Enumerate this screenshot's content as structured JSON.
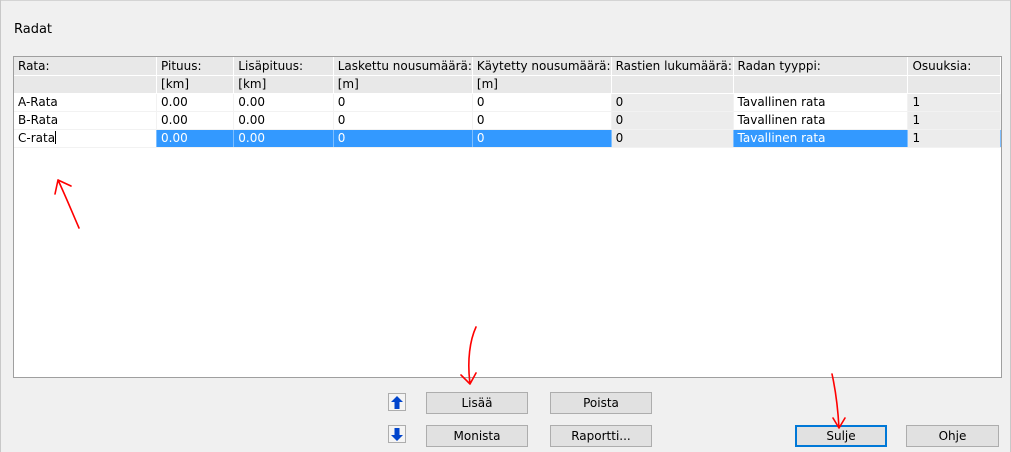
{
  "window": {
    "title": "Radat"
  },
  "table": {
    "columns": [
      {
        "label": "Rata:",
        "unit": ""
      },
      {
        "label": "Pituus:",
        "unit": "[km]"
      },
      {
        "label": "Lisäpituus:",
        "unit": "[km]"
      },
      {
        "label": "Laskettu nousumäärä:",
        "unit": "[m]"
      },
      {
        "label": "Käytetty nousumäärä:",
        "unit": "[m]"
      },
      {
        "label": "Rastien lukumäärä:",
        "unit": ""
      },
      {
        "label": "Radan tyyppi:",
        "unit": ""
      },
      {
        "label": "Osuuksia:",
        "unit": ""
      }
    ],
    "rows": [
      {
        "cells": [
          "A-Rata",
          "0.00",
          "0.00",
          "0",
          "0",
          "0",
          "Tavallinen rata",
          "1"
        ]
      },
      {
        "cells": [
          "B-Rata",
          "0.00",
          "0.00",
          "0",
          "0",
          "0",
          "Tavallinen rata",
          "1"
        ]
      },
      {
        "cells": [
          "C-rata",
          "0.00",
          "0.00",
          "0",
          "0",
          "0",
          "Tavallinen rata",
          "1"
        ],
        "selected": true
      }
    ]
  },
  "buttons": {
    "move_up_icon": "arrow-up-icon",
    "move_down_icon": "arrow-down-icon",
    "add": "Lisää",
    "delete": "Poista",
    "duplicate": "Monista",
    "report": "Raportti...",
    "close": "Sulje",
    "help": "Ohje"
  },
  "colors": {
    "selection": "#3399ff",
    "header_bg": "#e8e8e8",
    "arrow_icon": "#0044cc",
    "annotation": "#ff0000",
    "default_button_border": "#0078d7"
  }
}
